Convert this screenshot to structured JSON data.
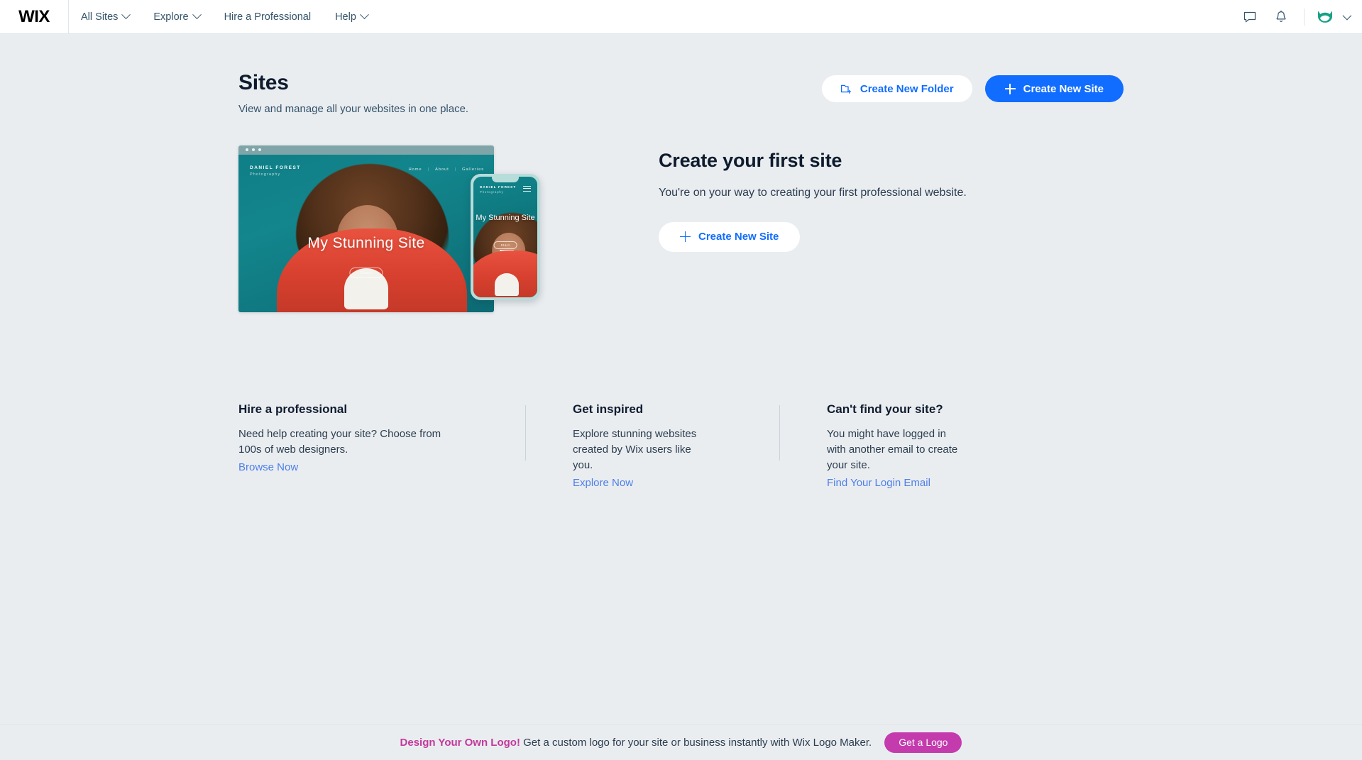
{
  "brand": {
    "logo": "WIX"
  },
  "topnav": {
    "items": [
      {
        "label": "All Sites",
        "has_chevron": true
      },
      {
        "label": "Explore",
        "has_chevron": true
      },
      {
        "label": "Hire a Professional",
        "has_chevron": false
      },
      {
        "label": "Help",
        "has_chevron": true
      }
    ],
    "icons": {
      "chat": "chat-bubble-icon",
      "notifications": "bell-icon",
      "avatar": "account-avatar-icon",
      "avatar_chevron": "chevron-down-icon"
    }
  },
  "header": {
    "title": "Sites",
    "subtitle": "View and manage all your websites in one place.",
    "create_folder_label": "Create New Folder",
    "create_site_label": "Create New Site"
  },
  "hero": {
    "title": "Create your first site",
    "text": "You're on your way to creating your first professional website.",
    "cta_label": "Create New Site",
    "preview": {
      "brand_name": "DANIEL FOREST",
      "brand_sub": "Photography",
      "nav": [
        "Home",
        "About",
        "Galleries"
      ],
      "nav_separator": "|",
      "site_title": "My Stunning Site",
      "site_cta": "Start",
      "mobile_title": "My Stunning Site",
      "mobile_cta": "Start"
    }
  },
  "info": {
    "columns": [
      {
        "title": "Hire a professional",
        "text": "Need help creating your site? Choose from 100s of web designers.",
        "link": "Browse Now"
      },
      {
        "title": "Get inspired",
        "text": "Explore stunning websites created by Wix users like you.",
        "link": "Explore Now"
      },
      {
        "title": "Can't find your site?",
        "text": "You might have logged in with another email to create your site.",
        "link": "Find Your Login Email"
      }
    ]
  },
  "banner": {
    "strong": "Design Your Own Logo!",
    "text": " Get a custom logo for your site or business instantly with Wix Logo Maker.",
    "button": "Get a Logo"
  },
  "colors": {
    "accent_blue": "#116dff",
    "link_blue": "#4d7fe8",
    "page_bg": "#eaedf0",
    "text_dark": "#0e1c2e",
    "text_muted": "#32536a",
    "magenta": "#c43bae",
    "avatar_teal": "#16a085"
  }
}
